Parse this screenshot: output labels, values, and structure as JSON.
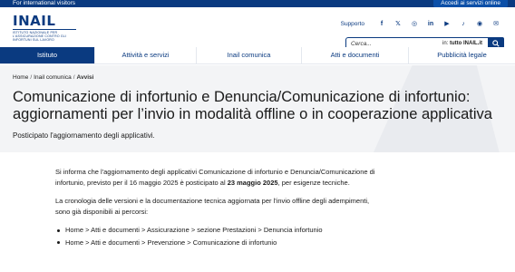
{
  "topbar": {
    "intl_link": "For international visitors",
    "access_button": "Accedi ai servizi online"
  },
  "logo": {
    "word": "INAIL",
    "tagline": "Istituto nazionale per l'assicurazione contro gli infortuni sul lavoro"
  },
  "header": {
    "supporto": "Supporto",
    "social_icons": [
      {
        "name": "facebook-icon",
        "glyph": "f"
      },
      {
        "name": "x-icon",
        "glyph": "𝕏"
      },
      {
        "name": "instagram-icon",
        "glyph": "◎"
      },
      {
        "name": "linkedin-icon",
        "glyph": "in"
      },
      {
        "name": "youtube-icon",
        "glyph": "▶"
      },
      {
        "name": "tiktok-icon",
        "glyph": "♪"
      },
      {
        "name": "podcast-icon",
        "glyph": "◉"
      },
      {
        "name": "newsletter-icon",
        "glyph": "✉"
      }
    ]
  },
  "search": {
    "placeholder": "Cerca...",
    "scope_prefix": "in:",
    "scope_value": "tutto INAIL.it"
  },
  "nav": {
    "items": [
      {
        "label": "Istituto",
        "active": true
      },
      {
        "label": "Attività e servizi",
        "active": false
      },
      {
        "label": "Inail comunica",
        "active": false
      },
      {
        "label": "Atti e documenti",
        "active": false
      },
      {
        "label": "Pubblicità legale",
        "active": false
      }
    ]
  },
  "breadcrumb": {
    "home": "Home",
    "section": "Inail comunica",
    "current": "Avvisi",
    "separator": "/"
  },
  "page": {
    "title": "Comunicazione di infortunio e Denuncia/Comunicazione di infortunio: aggiornamenti per l’invio in modalità offline o in cooperazione applicativa",
    "subtitle": "Posticipato l'aggiornamento degli applicativi."
  },
  "content": {
    "para1_before": "Si informa che l'aggiornamento degli applicativi Comunicazione di infortunio e Denuncia/Comunicazione di infortunio, previsto per il 16 maggio 2025 è posticipato al ",
    "para1_bold": "23 maggio 2025",
    "para1_after": ", per esigenze tecniche.",
    "para2": "La cronologia delle versioni e la documentazione tecnica aggiornata per l'invio offline degli adempimenti, sono già disponibili ai percorsi:",
    "paths": [
      "Home > Atti e documenti > Assicurazione > sezione Prestazioni > Denuncia infortunio",
      "Home > Atti e documenti > Prevenzione > Comunicazione di infortunio"
    ]
  },
  "colors": {
    "brand_blue": "#0a3a80",
    "hero_bg": "#f3f4f6"
  }
}
